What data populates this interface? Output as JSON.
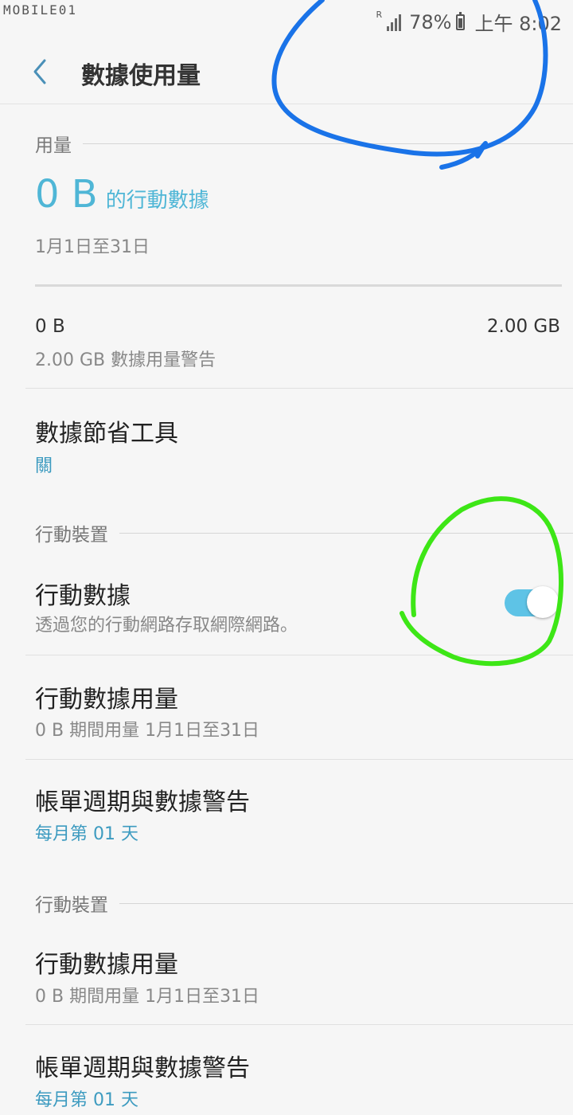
{
  "status_bar": {
    "watermark": "MOBILE01",
    "network_indicator": "R",
    "battery_percent": "78%",
    "time": "上午 8:02"
  },
  "header": {
    "title": "數據使用量"
  },
  "usage": {
    "section_label": "用量",
    "amount": "0 B",
    "amount_suffix": "的行動數據",
    "date_range": "1月1日至31日",
    "limit_left": "0 B",
    "limit_right": "2.00 GB",
    "warning_text": "2.00 GB 數據用量警告",
    "used_fraction": 0
  },
  "data_saver": {
    "title": "數據節省工具",
    "status": "關"
  },
  "mobile_section": {
    "label": "行動裝置",
    "mobile_data": {
      "title": "行動數據",
      "subtitle": "透過您的行動網路存取網際網路。",
      "enabled": true
    },
    "mobile_usage": {
      "title": "行動數據用量",
      "subtitle": "0 B 期間用量 1月1日至31日"
    },
    "billing": {
      "title": "帳單週期與數據警告",
      "subtitle": "每月第 01 天"
    }
  },
  "mobile_section_2": {
    "label": "行動裝置",
    "mobile_usage": {
      "title": "行動數據用量",
      "subtitle": "0 B 期間用量 1月1日至31日"
    },
    "billing": {
      "title": "帳單週期與數據警告",
      "subtitle": "每月第 01 天"
    }
  },
  "colors": {
    "accent": "#4fb6d6",
    "toggle_on": "#5ec3e6",
    "annotation_blue": "#1a73e8",
    "annotation_green": "#3de616"
  }
}
